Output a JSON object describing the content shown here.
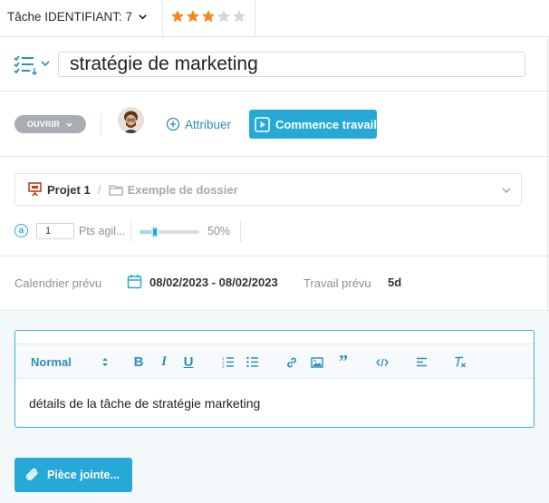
{
  "header": {
    "task_id_label": "Tâche IDENTIFIANT: 7",
    "rating": 3,
    "rating_max": 5,
    "star_color": "#f08c1f"
  },
  "task": {
    "title": "stratégie de marketing"
  },
  "actions": {
    "status_label": "OUVRIR",
    "assign_label": "Attribuer",
    "start_label": "Commence travail"
  },
  "project": {
    "project_name": "Projet 1",
    "separator": "/",
    "folder_placeholder": "Exemple de dossier"
  },
  "agile": {
    "icon_letter": "a",
    "points_value": "1",
    "points_label": "Pts agil...",
    "progress_percent": 50,
    "progress_label": "50%"
  },
  "schedule": {
    "calendar_label": "Calendrier prévu",
    "date_range": "08/02/2023 - 08/02/2023",
    "work_label": "Travail prévu",
    "work_value": "5d"
  },
  "editor": {
    "format_label": "Normal",
    "content": "détails de la tâche de stratégie marketing"
  },
  "attachment": {
    "label": "Pièce jointe..."
  },
  "colors": {
    "accent": "#27a9d8",
    "link": "#2d8fb5",
    "status_gray": "#a9adb3"
  }
}
